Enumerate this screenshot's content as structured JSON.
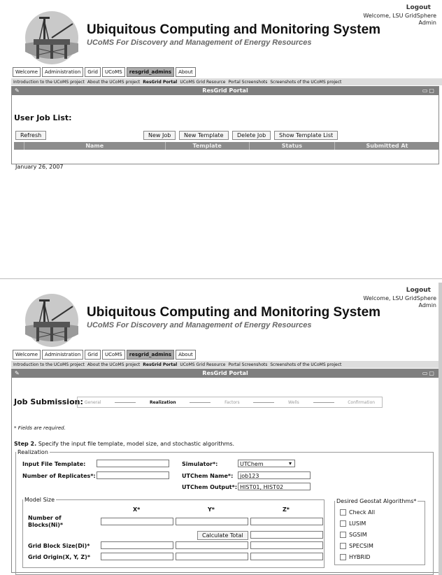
{
  "header": {
    "logout": "Logout",
    "welcome": "Welcome, LSU GridSphere Admin",
    "title": "Ubiquitous Computing and Monitoring System",
    "subtitle": "UCoMS For Discovery and Management of Energy Resources"
  },
  "tabs": [
    "Welcome",
    "Administration",
    "Grid",
    "UCoMS",
    "resgrid_admins",
    "About"
  ],
  "active_tab": "resgrid_admins",
  "links": [
    "Introduction to the UCoMS project",
    "About the UCoMS project",
    "ResGrid Portal",
    "UCoMS Grid Resource",
    "Portal Screenshots",
    "Screenshots of the UCoMS project"
  ],
  "active_link": "ResGrid Portal",
  "portal_title": "ResGrid Portal",
  "job_list": {
    "title": "User Job List:",
    "refresh": "Refresh",
    "new_job": "New Job",
    "new_template": "New Template",
    "delete_job": "Delete Job",
    "show_template_list": "Show Template List",
    "columns": [
      "Name",
      "Template",
      "Status",
      "Submitted At"
    ],
    "date": "January 26, 2007"
  },
  "job_submission": {
    "title": "Job Submission:",
    "steps": [
      "General",
      "Realization",
      "Factors",
      "Wells",
      "Confirmation"
    ],
    "current_step": "Realization",
    "required_note": "* Fields are required.",
    "step_label": "Step 2.",
    "step_text": "Specify the input file template, model size, and stochastic algorithms.",
    "realization_legend": "Realization",
    "input_file_template_label": "Input File Template:",
    "input_file_template_value": "",
    "replicates_label": "Number of Replicates*:",
    "replicates_value": "",
    "simulator_label": "Simulator*:",
    "simulator_value": "UTChem",
    "utchem_name_label": "UTChem Name*:",
    "utchem_name_value": "job123",
    "utchem_output_label": "UTChem Output*:",
    "utchem_output_value": "HIST01, HIST02",
    "model_size_legend": "Model Size",
    "x_header": "X*",
    "y_header": "Y*",
    "z_header": "Z*",
    "blocks_label": "Number of Blocks(Ni)*",
    "calculate_total": "Calculate Total",
    "grid_block_size_label": "Grid Block Size(Di)*",
    "grid_origin_label": "Grid Origin(X, Y, Z)*",
    "geostat_legend": "Desired Geostat Algorithms*",
    "algorithms": [
      "Check All",
      "LUSIM",
      "SGSIM",
      "SPECSIM",
      "HYBRID"
    ]
  }
}
